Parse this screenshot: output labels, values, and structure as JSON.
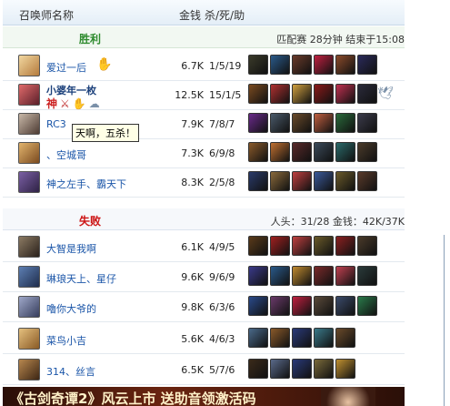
{
  "header": {
    "col_name": "召唤师名称",
    "col_gold": "金钱",
    "col_kda": "杀/死/助"
  },
  "win": {
    "title": "胜利",
    "info": "匹配赛  28分钟  结束于15:08",
    "players": [
      {
        "name": "爱过一后",
        "gold": "6.7K",
        "kda": "1/5/19",
        "items": [
          "#3a3a2a",
          "#2a5a8a",
          "#6a3a2a",
          "#c02040",
          "#8a4a2a",
          "#2a2a5a"
        ]
      },
      {
        "name": "小婆年一枚",
        "badge": "神",
        "gold": "12.5K",
        "kda": "15/1/5",
        "items": [
          "#7a4a20",
          "#b03030",
          "#d0a040",
          "#8a1a1a",
          "#c03050",
          "#2a2a3a"
        ]
      },
      {
        "name": "RC3",
        "gold": "7.9K",
        "kda": "7/8/7",
        "items": [
          "#6a2a8a",
          "#4a5a6a",
          "#6a4a2a",
          "#c06040",
          "#2a6a3a",
          "#3a3a4a"
        ]
      },
      {
        "name": "、空城哥",
        "gold": "7.3K",
        "kda": "6/9/8",
        "items": [
          "#8a5a2a",
          "#c07030",
          "#5a2a2a",
          "#3a4a5a",
          "#2a6a6a",
          "#4a3a2a"
        ]
      },
      {
        "name": "神之左手、霸天下",
        "gold": "8.3K",
        "kda": "2/5/8",
        "items": [
          "#2a3a6a",
          "#8a6a3a",
          "#c04040",
          "#3a5a9a",
          "#6a5a2a",
          "#5a3a2a"
        ]
      }
    ]
  },
  "lose": {
    "title": "失败",
    "info": "人头：31/28  金钱：42K/37K",
    "players": [
      {
        "name": "大智是我啊",
        "gold": "6.1K",
        "kda": "4/9/5",
        "items": [
          "#5a3a1a",
          "#a02020",
          "#c04040",
          "#6a5a2a",
          "#8a2020",
          "#4a3a2a"
        ]
      },
      {
        "name": "琳琅天上、星仔",
        "gold": "9.6K",
        "kda": "9/6/9",
        "items": [
          "#3a3a8a",
          "#2a5a8a",
          "#c08a30",
          "#7a2a2a",
          "#c04050",
          "#2a3a3a"
        ]
      },
      {
        "name": "嚕你大爷的",
        "gold": "9.8K",
        "kda": "6/3/6",
        "items": [
          "#2a4a8a",
          "#6a3a6a",
          "#c02040",
          "#5a4a3a",
          "#3a4a6a",
          "#2a7a4a"
        ]
      },
      {
        "name": "菜鸟小吉",
        "gold": "5.6K",
        "kda": "4/6/3",
        "items": [
          "#4a6a8a",
          "#8a5a2a",
          "#2a3a7a",
          "#3a7a8a",
          "#6a4a2a"
        ]
      },
      {
        "name": "314、丝言",
        "gold": "6.5K",
        "kda": "5/7/6",
        "items": [
          "#3a2a1a",
          "#5a6a8a",
          "#2a3a7a",
          "#7a6a3a",
          "#c09030"
        ]
      }
    ]
  },
  "tooltip": "天啊，五杀！",
  "banner": "《古剑奇谭2》风云上市  送助音领激活码"
}
